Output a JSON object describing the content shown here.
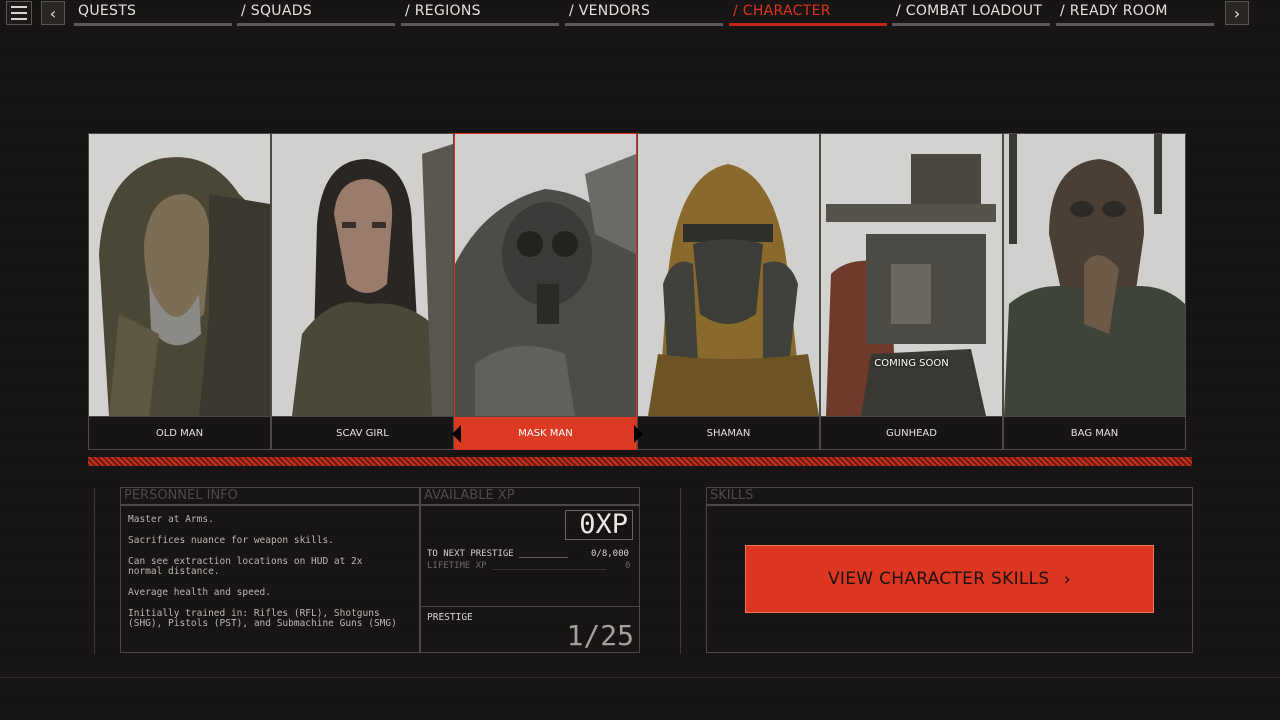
{
  "nav": {
    "tabs": [
      "QUESTS",
      "/ SQUADS",
      "/ REGIONS",
      "/ VENDORS",
      "/ CHARACTER",
      "/ COMBAT LOADOUT",
      "/ READY ROOM"
    ],
    "active_tab": "/ CHARACTER",
    "prev_icon": "chevron-left-icon",
    "next_icon": "chevron-right-icon",
    "menu_icon": "hamburger-menu-icon"
  },
  "characters": [
    {
      "name": "OLD MAN"
    },
    {
      "name": "SCAV GIRL"
    },
    {
      "name": "MASK MAN",
      "selected": true
    },
    {
      "name": "SHAMAN"
    },
    {
      "name": "GUNHEAD",
      "status": "COMING SOON"
    },
    {
      "name": "BAG MAN"
    }
  ],
  "personnel": {
    "header": "PERSONNEL INFO",
    "lines": [
      "Master at Arms.",
      "Sacrifices nuance for weapon skills.",
      "Can see extraction locations on HUD at 2x normal distance.",
      "Average health and speed.",
      "Initially trained in: Rifles (RFL), Shotguns (SHG), Pistols (PST), and Submachine Guns (SMG)"
    ]
  },
  "xp": {
    "header": "AVAILABLE XP",
    "value": "0XP",
    "to_next_label": "TO NEXT PRESTIGE _________",
    "to_next_value": "0/8,000",
    "lifetime_label": "LIFETIME XP _____________________",
    "lifetime_value": "0"
  },
  "prestige": {
    "label": "PRESTIGE",
    "value": "1/25"
  },
  "skills": {
    "header": "SKILLS",
    "button_label": "VIEW CHARACTER SKILLS",
    "button_icon": "chevron-right-icon"
  },
  "colors": {
    "accent": "#dc3620",
    "background": "#151313"
  }
}
